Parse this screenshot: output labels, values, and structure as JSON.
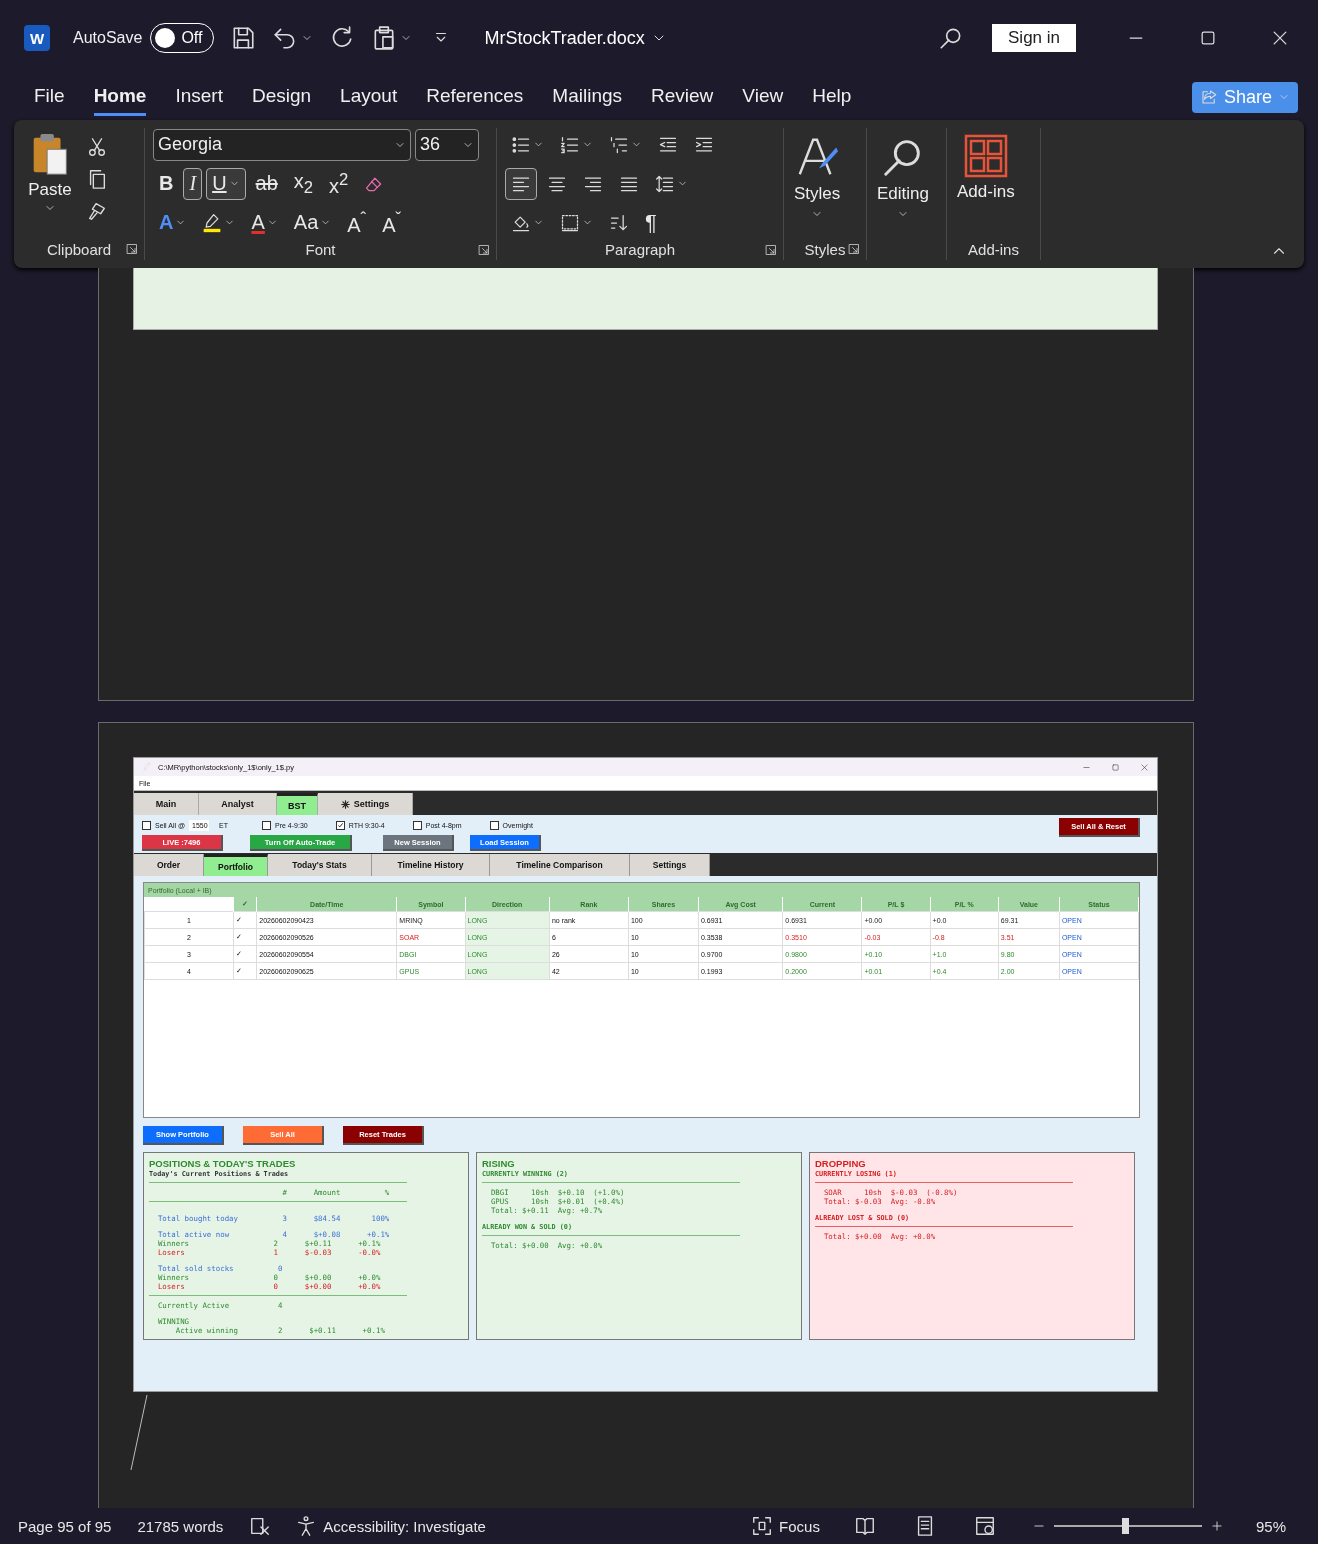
{
  "window": {
    "logo": "W",
    "autosave_label": "AutoSave",
    "autosave": {
      "on": false,
      "label": "Off"
    },
    "title": "MrStockTrader.docx",
    "sign_in": "Sign in"
  },
  "menu_tabs": [
    {
      "label": "File",
      "selected": false
    },
    {
      "label": "Home",
      "selected": true
    },
    {
      "label": "Insert",
      "selected": false
    },
    {
      "label": "Design",
      "selected": false
    },
    {
      "label": "Layout",
      "selected": false
    },
    {
      "label": "References",
      "selected": false
    },
    {
      "label": "Mailings",
      "selected": false
    },
    {
      "label": "Review",
      "selected": false
    },
    {
      "label": "View",
      "selected": false
    },
    {
      "label": "Help",
      "selected": false
    }
  ],
  "share": "Share",
  "ribbon": {
    "clipboard": {
      "paste": "Paste",
      "group": "Clipboard"
    },
    "font": {
      "family": "Georgia",
      "size": "36",
      "group": "Font",
      "row1": [
        {
          "glyph": "B",
          "kind": "bold",
          "selected": false,
          "caret": false
        },
        {
          "glyph": "I",
          "kind": "italic",
          "selected": true,
          "caret": false
        },
        {
          "glyph": "U",
          "kind": "underline",
          "selected": true,
          "caret": true
        },
        {
          "glyph": "ab",
          "kind": "strikethrough",
          "selected": false,
          "caret": false
        },
        {
          "glyph": "x$_{2}$",
          "kind": "subscript",
          "selected": false,
          "caret": false
        },
        {
          "glyph": "x$^{2}$",
          "kind": "superscript",
          "selected": false,
          "caret": false
        },
        {
          "kind": "clear",
          "selected": false,
          "caret": false
        }
      ],
      "row2": [
        {
          "glyph": "A",
          "kind": "effects",
          "selected": false,
          "caret": true
        },
        {
          "kind": "highlight",
          "selected": false,
          "caret": true
        },
        {
          "glyph": "A",
          "kind": "font-color",
          "selected": false,
          "caret": true
        },
        {
          "glyph": "Aa",
          "kind": "case",
          "selected": false,
          "caret": true
        },
        {
          "glyph": "A$^{ˆ}$",
          "kind": "grow",
          "selected": false,
          "caret": false
        },
        {
          "glyph": "A$^{ˇ}$",
          "kind": "shrink",
          "selected": false,
          "caret": false
        }
      ]
    },
    "paragraph": {
      "group": "Paragraph",
      "row1": [
        {
          "kind": "bullets",
          "selected": false,
          "caret": true
        },
        {
          "kind": "numbering",
          "selected": false,
          "caret": true
        },
        {
          "kind": "multilevel",
          "selected": false,
          "caret": true
        },
        {
          "kind": "outdent",
          "selected": false,
          "caret": false
        },
        {
          "kind": "indent",
          "selected": false,
          "caret": false
        }
      ],
      "row2": [
        {
          "kind": "align-left",
          "selected": true,
          "caret": false
        },
        {
          "kind": "align-center",
          "selected": false,
          "caret": false
        },
        {
          "kind": "align-right",
          "selected": false,
          "caret": false
        },
        {
          "kind": "justify",
          "selected": false,
          "caret": false
        },
        {
          "kind": "line-spacing",
          "selected": false,
          "caret": true
        }
      ],
      "row3": [
        {
          "kind": "shading",
          "selected": false,
          "caret": true
        },
        {
          "kind": "borders",
          "selected": false,
          "caret": true
        },
        {
          "kind": "sort",
          "selected": false,
          "caret": false
        },
        {
          "glyph": "¶",
          "kind": "pilcrow",
          "selected": false,
          "caret": false
        }
      ]
    },
    "styles": {
      "label": "Styles",
      "group": "Styles"
    },
    "editing": {
      "label": "Editing"
    },
    "addins": {
      "label": "Add-ins",
      "group": "Add-ins"
    }
  },
  "app": {
    "title": "C:\\MR\\python\\stocks\\only_1$\\only_1$.py",
    "menu": [
      "File"
    ],
    "main_tabs": [
      {
        "label": "Main",
        "selected": false,
        "icon": false
      },
      {
        "label": "Analyst",
        "selected": false,
        "icon": false
      },
      {
        "label": "BST",
        "selected": true,
        "icon": false
      },
      {
        "label": "Settings",
        "selected": false,
        "icon": true
      }
    ],
    "sell_all": {
      "label": "Sell All @",
      "checked": false,
      "value": "1550",
      "unit": "ET"
    },
    "sessions": [
      {
        "label": "Pre 4-9:30",
        "checked": false
      },
      {
        "label": "RTH 9:30-4",
        "checked": true
      },
      {
        "label": "Post 4-8pm",
        "checked": false
      },
      {
        "label": "Overnight",
        "checked": false
      }
    ],
    "sell_reset": "Sell All & Reset",
    "actions": [
      {
        "label": "LIVE :7496",
        "color": "#dc3545"
      },
      {
        "label": "Turn Off Auto-Trade",
        "color": "#28a745"
      },
      {
        "label": "New Session",
        "color": "#6c757d"
      },
      {
        "label": "Load Session",
        "color": "#0d6efd"
      }
    ],
    "sub_tabs": [
      {
        "label": "Order",
        "selected": false
      },
      {
        "label": "Portfolio",
        "selected": true
      },
      {
        "label": "Today's Stats",
        "selected": false
      },
      {
        "label": "Timeline History",
        "selected": false
      },
      {
        "label": "Timeline Comparison",
        "selected": false
      },
      {
        "label": "Settings",
        "selected": false
      }
    ],
    "portfolio": {
      "title": "Portfolio (Local + IB)",
      "columns": [
        "",
        "✓",
        "Date/Time",
        "Symbol",
        "Direction",
        "Rank",
        "Shares",
        "Avg Cost",
        "Current",
        "P/L $",
        "P/L %",
        "Value",
        "Status"
      ],
      "rows": [
        {
          "gain": false,
          "loss": false,
          "cells": [
            "1",
            "✓",
            "20260602090423",
            "MRINQ",
            "LONG",
            "no rank",
            "100",
            "0.6931",
            "0.6931",
            "+0.00",
            "+0.0",
            "69.31",
            "OPEN"
          ]
        },
        {
          "gain": false,
          "loss": true,
          "cells": [
            "2",
            "✓",
            "20260602090526",
            "SOAR",
            "LONG",
            "6",
            "10",
            "0.3538",
            "0.3510",
            "-0.03",
            "-0.8",
            "3.51",
            "OPEN"
          ]
        },
        {
          "gain": true,
          "loss": false,
          "cells": [
            "3",
            "✓",
            "20260602090554",
            "DBGI",
            "LONG",
            "26",
            "10",
            "0.9700",
            "0.9800",
            "+0.10",
            "+1.0",
            "9.80",
            "OPEN"
          ]
        },
        {
          "gain": true,
          "loss": false,
          "cells": [
            "4",
            "✓",
            "20260602090625",
            "GPUS",
            "LONG",
            "42",
            "10",
            "0.1993",
            "0.2000",
            "+0.01",
            "+0.4",
            "2.00",
            "OPEN"
          ]
        }
      ]
    },
    "buttons": [
      {
        "label": "Show Portfolio",
        "color": "#0d6efd"
      },
      {
        "label": "Sell All",
        "color": "#ff6b35"
      },
      {
        "label": "Reset Trades",
        "color": "#8b0000"
      }
    ],
    "panels": [
      {
        "loss": false,
        "items": [
          {
            "kind": "title",
            "text": "POSITIONS & TODAY'S TRADES"
          },
          {
            "kind": "subtitle",
            "text": "Today's Current Positions & Trades"
          },
          {
            "kind": "rule"
          },
          {
            "kind": "line",
            "text": "                              #      Amount          %"
          },
          {
            "kind": "rule"
          },
          {
            "kind": "total",
            "text": "  Total bought today          3      $84.54       100%",
            "gap": true
          },
          {
            "kind": "total",
            "text": "  Total active now            4      $+0.08      +0.1%",
            "gap": true
          },
          {
            "kind": "winner",
            "text": "  Winners                   2      $+0.11      +0.1%"
          },
          {
            "kind": "loser",
            "text": "  Losers                    1      $-0.03      -0.0%"
          },
          {
            "kind": "total",
            "text": "  Total sold stocks          0",
            "gap": true
          },
          {
            "kind": "winner",
            "text": "  Winners                   0      $+0.00      +0.0%"
          },
          {
            "kind": "loser",
            "text": "  Losers                    0      $+0.00      +0.0%"
          },
          {
            "kind": "rule"
          },
          {
            "kind": "line",
            "text": "  Currently Active           4"
          },
          {
            "kind": "line",
            "text": "  WINNING",
            "gap": true
          },
          {
            "kind": "line",
            "text": "      Active winning         2      $+0.11      +0.1%"
          }
        ]
      },
      {
        "loss": false,
        "items": [
          {
            "kind": "title",
            "text": "RISING"
          },
          {
            "kind": "heading",
            "text": "CURRENTLY WINNING (2)"
          },
          {
            "kind": "rule"
          },
          {
            "kind": "line",
            "text": "  DBGI     10sh  $+0.10  (+1.0%)"
          },
          {
            "kind": "line",
            "text": "  GPUS     10sh  $+0.01  (+0.4%)"
          },
          {
            "kind": "line",
            "text": "  Total: $+0.11  Avg: +0.7%"
          },
          {
            "kind": "heading",
            "text": "ALREADY WON & SOLD (0)",
            "gap": true
          },
          {
            "kind": "rule"
          },
          {
            "kind": "line",
            "text": "  Total: $+0.00  Avg: +0.0%"
          }
        ]
      },
      {
        "loss": true,
        "items": [
          {
            "kind": "title",
            "text": "DROPPING"
          },
          {
            "kind": "heading",
            "text": "CURRENTLY LOSING (1)"
          },
          {
            "kind": "rule"
          },
          {
            "kind": "line",
            "text": "  SOAR     10sh  $-0.03  (-0.8%)"
          },
          {
            "kind": "line",
            "text": "  Total: $-0.03  Avg: -0.8%"
          },
          {
            "kind": "heading",
            "text": "ALREADY LOST & SOLD (0)",
            "gap": true
          },
          {
            "kind": "rule"
          },
          {
            "kind": "line",
            "text": "  Total: $+0.00  Avg: +0.0%"
          }
        ]
      }
    ]
  },
  "status_bar": {
    "page": "Page 95 of 95",
    "words": "21785 words",
    "accessibility": "Accessibility: Investigate",
    "focus": "Focus",
    "zoom": "95%",
    "zoom_slider": {
      "level": 0.48
    }
  }
}
